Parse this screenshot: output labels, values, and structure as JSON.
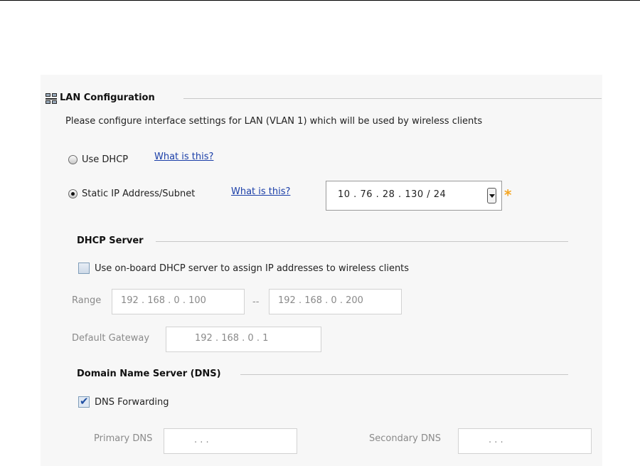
{
  "lan": {
    "title": "LAN Configuration",
    "description": "Please configure interface settings for LAN (VLAN 1) which will be used by wireless clients",
    "use_dhcp_label": "Use DHCP",
    "use_dhcp_help": "What is this?",
    "static_label": "Static IP Address/Subnet",
    "static_help": "What is this?",
    "static_ip": "10 .  76 .  28 . 130 /   24",
    "required_mark": "*"
  },
  "dhcp_server": {
    "title": "DHCP Server",
    "checkbox_label": "Use on-board DHCP server to assign IP addresses to wireless clients",
    "range_label": "Range",
    "range_start": "192 . 168 .   0  . 100",
    "range_separator": "--",
    "range_end": "192 . 168 .   0  . 200",
    "gateway_label": "Default Gateway",
    "gateway_value": "192 . 168 .   0  .   1"
  },
  "dns": {
    "title": "Domain Name Server (DNS)",
    "forwarding_label": "DNS Forwarding",
    "primary_label": "Primary DNS",
    "primary_value": ".       .       .",
    "secondary_label": "Secondary DNS",
    "secondary_value": ".       .       ."
  }
}
